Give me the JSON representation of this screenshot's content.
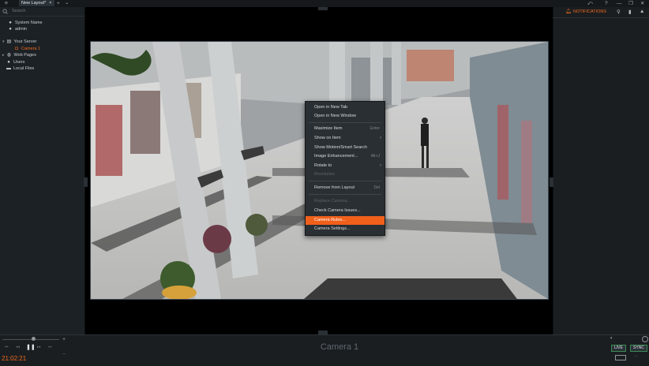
{
  "titlebar": {
    "tab_label": "New Layout*",
    "tab_close": "×",
    "add_tab": "+",
    "menu_icon": "≡",
    "tabs_dropdown": "⌄",
    "right_icons": [
      "⤺",
      "?",
      "—",
      "❐",
      "✕"
    ]
  },
  "left_panel": {
    "search_placeholder": "Search",
    "items": [
      {
        "label": "System Name",
        "icon": "resource-icon"
      },
      {
        "label": "admin",
        "icon": "user-icon"
      },
      {
        "label": "Your Server",
        "icon": "server-icon"
      },
      {
        "label": "Camera 1",
        "icon": "camera-icon"
      },
      {
        "label": "Web Pages",
        "icon": "globe-icon"
      },
      {
        "label": "Users",
        "icon": "users-icon"
      },
      {
        "label": "Local Files",
        "icon": "folder-icon"
      }
    ]
  },
  "right_panel": {
    "notifications_label": "NOTIFICATIONS"
  },
  "context_menu": {
    "items": [
      {
        "label": "Open in New Tab",
        "shortcut": "",
        "submenu": false,
        "disabled": false
      },
      {
        "label": "Open in New Window",
        "shortcut": "",
        "submenu": false,
        "disabled": false
      },
      {
        "label": "Maximize Item",
        "shortcut": "Enter",
        "submenu": false,
        "disabled": false
      },
      {
        "label": "Show on Item",
        "shortcut": "",
        "submenu": true,
        "disabled": false
      },
      {
        "label": "Show Motion/Smart Search",
        "shortcut": "",
        "submenu": false,
        "disabled": false
      },
      {
        "label": "Image Enhancement...",
        "shortcut": "Alt+J",
        "submenu": false,
        "disabled": false
      },
      {
        "label": "Rotate to",
        "shortcut": "",
        "submenu": true,
        "disabled": false
      },
      {
        "label": "Resolution",
        "shortcut": "",
        "submenu": false,
        "disabled": true
      },
      {
        "label": "Remove from Layout",
        "shortcut": "Del",
        "submenu": false,
        "disabled": false
      },
      {
        "label": "Replace Camera...",
        "shortcut": "",
        "submenu": false,
        "disabled": true
      },
      {
        "label": "Check Camera Issues...",
        "shortcut": "",
        "submenu": false,
        "disabled": false
      },
      {
        "label": "Camera Rules...",
        "shortcut": "",
        "submenu": false,
        "disabled": false,
        "highlighted": true
      },
      {
        "label": "Camera Settings...",
        "shortcut": "",
        "submenu": false,
        "disabled": false
      }
    ]
  },
  "bottom": {
    "camera_label": "Camera 1",
    "time": "21:02:21",
    "live_label": "LIVE",
    "sync_label": "SYNC",
    "plus": "+",
    "minus": "−"
  },
  "colors": {
    "accent": "#f06a1d",
    "menu_highlight": "#f0601b",
    "panel_bg": "#1c2125",
    "live_border": "#3b8a56"
  }
}
